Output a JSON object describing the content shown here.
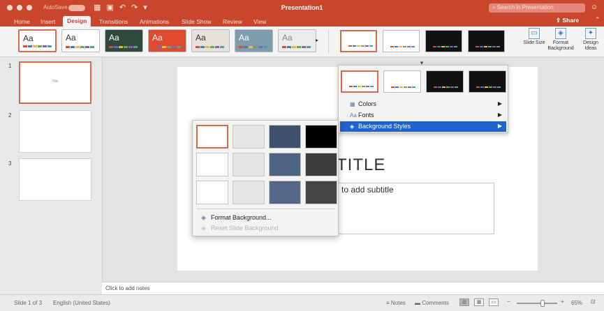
{
  "window": {
    "title": "Presentation1",
    "autosave_label": "AutoSave",
    "qat_icons": [
      "grid-icon",
      "save-icon",
      "undo-icon",
      "redo-icon",
      "customize-icon"
    ],
    "search_placeholder": "Search in Presentation",
    "accent_color": "#c9462c"
  },
  "tabs": [
    "Home",
    "Insert",
    "Design",
    "Transitions",
    "Animations",
    "Slide Show",
    "Review",
    "View"
  ],
  "active_tab": "Design",
  "share_label": "Share",
  "ribbon": {
    "themes": [
      {
        "label": "Aa",
        "bg": "#ffffff",
        "fg": "#333333"
      },
      {
        "label": "Aa",
        "bg": "#ffffff",
        "fg": "#333333"
      },
      {
        "label": "Aa",
        "bg": "#2f4a3d",
        "fg": "#ffffff"
      },
      {
        "label": "Aa",
        "bg": "#e04a2e",
        "fg": "#ffffff"
      },
      {
        "label": "Aa",
        "bg": "#e6e1da",
        "fg": "#333333"
      },
      {
        "label": "Aa",
        "bg": "#7e9dac",
        "fg": "#ffffff"
      },
      {
        "label": "Aa",
        "bg": "#ececec",
        "fg": "#888888"
      }
    ],
    "variants": [
      {
        "bg": "#ffffff"
      },
      {
        "bg": "#ffffff"
      },
      {
        "bg": "#111111"
      },
      {
        "bg": "#111111"
      }
    ],
    "buttons": {
      "slide_size": "Slide Size",
      "format_background": "Format Background",
      "design_ideas": "Design Ideas"
    }
  },
  "slides": [
    {
      "number": "1",
      "title": "Title"
    },
    {
      "number": "2",
      "title": ""
    },
    {
      "number": "3",
      "title": ""
    }
  ],
  "slide": {
    "title": "TITLE",
    "subtitle_placeholder": "to add subtitle"
  },
  "notes_placeholder": "Click to add notes",
  "variants_menu": {
    "items": [
      {
        "label": "Colors",
        "icon": "colors-icon"
      },
      {
        "label": "Fonts",
        "icon": "fonts-icon"
      },
      {
        "label": "Background Styles",
        "icon": "background-styles-icon"
      }
    ],
    "highlighted": "Background Styles",
    "highlight_color": "#1e63cf"
  },
  "background_styles": {
    "swatches": [
      "#ffffff",
      "#e6e6e6",
      "#41506d",
      "#000000",
      "#ffffff",
      "#e3e3e3",
      "#4f6384",
      "#3c3c3c",
      "#ffffff",
      "#e6e6e6",
      "#55678a",
      "#444444"
    ],
    "format_background": "Format Background...",
    "reset_background": "Reset Slide Background"
  },
  "status": {
    "slide_count": "Slide 1 of 3",
    "language": "English (United States)",
    "notes": "Notes",
    "comments": "Comments",
    "zoom": "65%",
    "zoom_level": 0.65
  }
}
